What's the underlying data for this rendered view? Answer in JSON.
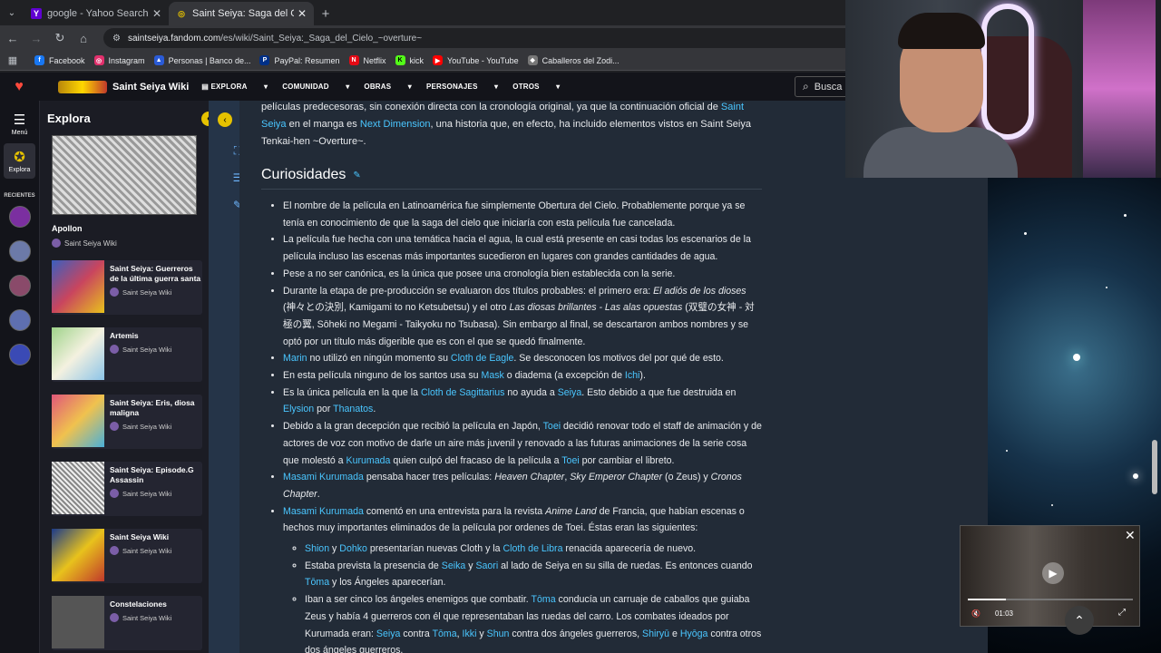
{
  "browser": {
    "tabs": [
      {
        "label": "google - Yahoo Search Tus res",
        "favicon": "Y",
        "active": false
      },
      {
        "label": "Saint Seiya: Saga del Cielo ~ove",
        "favicon": "◎",
        "active": true
      }
    ],
    "url_prefix": "saintseiya.fandom.com",
    "url_rest": "/es/wiki/Saint_Seiya:_Saga_del_Cielo_~overture~",
    "bookmarks": [
      {
        "label": "Facebook",
        "color": "#1877f2",
        "icon": "f"
      },
      {
        "label": "Instagram",
        "color": "#e1306c",
        "icon": "◎"
      },
      {
        "label": "Personas | Banco de...",
        "color": "#2a5bd7",
        "icon": "▲"
      },
      {
        "label": "PayPal: Resumen",
        "color": "#003087",
        "icon": "P"
      },
      {
        "label": "Netflix",
        "color": "#e50914",
        "icon": "N"
      },
      {
        "label": "kick",
        "color": "#53fc18",
        "icon": "K"
      },
      {
        "label": "YouTube - YouTube",
        "color": "#ff0000",
        "icon": "▶"
      },
      {
        "label": "Caballeros del Zodi...",
        "color": "#777777",
        "icon": "❖"
      }
    ]
  },
  "fandom": {
    "wiki_name": "Saint Seiya Wiki",
    "nav": [
      "EXPLORA",
      "COMUNIDAD",
      "OBRAS",
      "PERSONAJES",
      "OTROS"
    ],
    "search_placeholder": "Busca"
  },
  "rail": {
    "menu": "Menú",
    "explora": "Explora",
    "recientes": "RECIENTES"
  },
  "explora_panel": {
    "title": "Explora",
    "big_card": {
      "title": "Apollon",
      "wiki": "Saint Seiya Wiki"
    },
    "cards": [
      {
        "title": "Saint Seiya: Guerreros de la última guerra santa",
        "wiki": "Saint Seiya Wiki",
        "color": "#3a5fbf"
      },
      {
        "title": "Artemis",
        "wiki": "Saint Seiya Wiki",
        "color": "#9fd38a"
      },
      {
        "title": "Saint Seiya: Eris, diosa maligna",
        "wiki": "Saint Seiya Wiki",
        "color": "#e0577a"
      },
      {
        "title": "Saint Seiya: Episode.G Assassin",
        "wiki": "Saint Seiya Wiki",
        "color": "#cfcfcf"
      },
      {
        "title": "Saint Seiya Wiki",
        "wiki": "Saint Seiya Wiki",
        "color": "#e8c21c"
      },
      {
        "title": "Constelaciones",
        "wiki": "Saint Seiya Wiki",
        "color": "#888888"
      }
    ]
  },
  "article": {
    "intro": {
      "t1": "películas predecesoras, sin conexión directa con la cronología original, ya que la continuación oficial de ",
      "l1": "Saint Seiya",
      "t2": " en el manga es ",
      "l2": "Next Dimension",
      "t3": ", una historia que, en efecto, ha incluido elementos vistos en Saint Seiya Tenkai-hen ~Overture~."
    },
    "heading": "Curiosidades",
    "items": {
      "i1": "El nombre de la película en Latinoamérica fue simplemente Obertura del Cielo. Probablemente porque ya se tenía en conocimiento de que la saga del cielo que iniciaría con esta película fue cancelada.",
      "i2": "La película fue hecha con una temática hacia el agua, la cual está presente en casi todas los escenarios de la película incluso las escenas más importantes sucedieron en lugares con grandes cantidades de agua.",
      "i3": "Pese a no ser canónica, es la única que posee una cronología bien establecida con la serie.",
      "i4a": "Durante la etapa de pre-producción se evaluaron dos títulos probables: el primero era: ",
      "i4b": "El adiós de los dioses",
      "i4c": " (神々との決別, Kamigami to no Ketsubetsu) y el otro ",
      "i4d": "Las diosas brillantes - Las alas opuestas",
      "i4e": " (双璧の女神 - 対極の翼, Sōheki no Megami - Taikyoku no Tsubasa). Sin embargo al final, se descartaron ambos nombres y se optó por un título más digerible que es con el que se quedó finalmente.",
      "i5l1": "Marin",
      "i5a": " no utilizó en ningún momento su ",
      "i5l2": "Cloth de Eagle",
      "i5b": ". Se desconocen los motivos del por qué de esto.",
      "i6a": "En esta película ninguno de los santos usa su ",
      "i6l1": "Mask",
      "i6b": " o diadema (a excepción de ",
      "i6l2": "Ichi",
      "i6c": ").",
      "i7a": "Es la única película en la que la ",
      "i7l1": "Cloth de Sagittarius",
      "i7b": " no ayuda a ",
      "i7l2": "Seiya",
      "i7c": ". Esto debido a que fue destruida en ",
      "i7l3": "Elysion",
      "i7d": " por ",
      "i7l4": "Thanatos",
      "i7e": ".",
      "i8a": "Debido a la gran decepción que recibió la película en Japón, ",
      "i8l1": "Toei",
      "i8b": " decidió renovar todo el staff de animación y de actores de voz con motivo de darle un aire más juvenil y renovado a las futuras animaciones de la serie cosa que molestó a ",
      "i8l2": "Kurumada",
      "i8c": " quien culpó del fracaso de la película a ",
      "i8l3": "Toei",
      "i8d": " por cambiar el libreto.",
      "i9l1": "Masami Kurumada",
      "i9a": " pensaba hacer tres películas: ",
      "i9b": "Heaven Chapter",
      "i9c": ", ",
      "i9d": "Sky Emperor Chapter",
      "i9e": " (o Zeus) y ",
      "i9f": "Cronos Chapter",
      "i9g": ".",
      "i10l1": "Masami Kurumada",
      "i10a": " comentó en una entrevista para la revista ",
      "i10b": "Anime Land",
      "i10c": " de Francia, que habían escenas o hechos muy importantes eliminados de la película por ordenes de Toei. Éstas eran las siguientes:",
      "s1l1": "Shion",
      "s1a": " y ",
      "s1l2": "Dohko",
      "s1b": " presentarían nuevas Cloth y la ",
      "s1l3": "Cloth de Libra",
      "s1c": " renacida aparecería de nuevo.",
      "s2a": "Estaba prevista la presencia de ",
      "s2l1": "Seika",
      "s2b": " y ",
      "s2l2": "Saori",
      "s2c": " al lado de Seiya en su silla de ruedas. Es entonces cuando ",
      "s2l3": "Tōma",
      "s2d": " y los Ángeles aparecerían.",
      "s3a": "Iban a ser cinco los ángeles enemigos que combatir. ",
      "s3l1": "Tōma",
      "s3b": " conducía un carruaje de caballos que guiaba Zeus y había 4 guerreros con él que representaban las ruedas del carro. Los combates ideados por Kurumada eran: ",
      "s3l2": "Seiya",
      "s3c": " contra ",
      "s3l3": "Tōma",
      "s3d": ", ",
      "s3l4": "Ikki",
      "s3e": " y ",
      "s3l5": "Shun",
      "s3f": " contra dos ángeles guerreros, ",
      "s3l6": "Shiryū",
      "s3g": " e ",
      "s3l7": "Hyōga",
      "s3h": " contra otros dos ángeles guerreros."
    }
  },
  "video": {
    "time": "01:03",
    "progress": 0.23
  },
  "colors": {
    "link": "#4ac6ff",
    "fandom_accent": "#e6c200",
    "content_bg": "#222b37"
  }
}
